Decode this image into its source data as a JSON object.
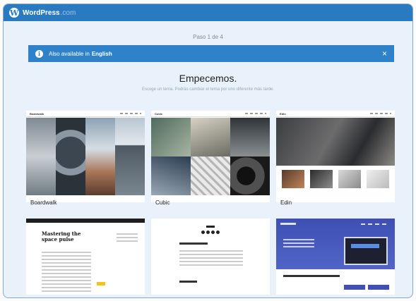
{
  "header": {
    "brand_main": "WordPress",
    "brand_suffix": ".com"
  },
  "step": {
    "label": "Paso 1 de 4"
  },
  "notice": {
    "prefix": "Also available in",
    "language": "English",
    "close": "×"
  },
  "main": {
    "title": "Empecemos.",
    "subtitle": "Escoge un tema. Podrás cambiar el tema por uno diferente más tarde."
  },
  "themes": [
    {
      "name": "Boardwalk"
    },
    {
      "name": "Cubic"
    },
    {
      "name": "Edin"
    },
    {
      "name": ""
    },
    {
      "name": ""
    },
    {
      "name": ""
    }
  ],
  "previews": {
    "sela_heading": "Mastering the space pulse",
    "edin_hero": ""
  },
  "colors": {
    "brand_blue": "#2a7ac2",
    "notice_blue": "#2f82c9",
    "page_bg": "#e9f2fa"
  }
}
